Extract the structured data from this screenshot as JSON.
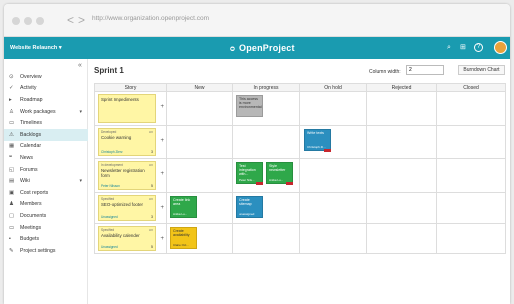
{
  "browser": {
    "url": "http://www.organization.openproject.com",
    "back": "<",
    "forward": ">"
  },
  "header": {
    "project": "Website Relaunch",
    "project_caret": "▾",
    "logo_mark": "ᴑ",
    "logo": "OpenProject",
    "search_icon": "⌕",
    "grid_icon": "⊞",
    "help_icon": "?",
    "accent": "#1a9bb0"
  },
  "sidebar": {
    "collapse": "«",
    "items": [
      {
        "label": "Overview",
        "icon": "⊙"
      },
      {
        "label": "Activity",
        "icon": "✓"
      },
      {
        "label": "Roadmap",
        "icon": "▸"
      },
      {
        "label": "Work packages",
        "icon": "♙",
        "chevron": "▾"
      },
      {
        "label": "Timelines",
        "icon": "▭"
      },
      {
        "label": "Backlogs",
        "icon": "⚠"
      },
      {
        "label": "Calendar",
        "icon": "▦"
      },
      {
        "label": "News",
        "icon": "❝"
      },
      {
        "label": "Forums",
        "icon": "◱"
      },
      {
        "label": "Wiki",
        "icon": "▤",
        "chevron": "▾"
      },
      {
        "label": "Cost reports",
        "icon": "▣"
      },
      {
        "label": "Members",
        "icon": "♟"
      },
      {
        "label": "Documents",
        "icon": "▢"
      },
      {
        "label": "Meetings",
        "icon": "▭"
      },
      {
        "label": "Budgets",
        "icon": "▪"
      },
      {
        "label": "Project settings",
        "icon": "✎"
      }
    ]
  },
  "main": {
    "title": "Sprint 1",
    "column_width_label": "Column width:",
    "column_width_value": "2",
    "burndown_label": "Burndown Chart",
    "columns": [
      "Story",
      "New",
      "In progress",
      "On hold",
      "Rejected",
      "Closed"
    ],
    "stories": [
      {
        "type": "",
        "title": "Sprint Impediments",
        "assignee": "",
        "points": "",
        "badge": ""
      },
      {
        "type": "Developed",
        "title": "Cookie warning",
        "assignee": "Christoph Zierz",
        "points": "3",
        "badge": "UV"
      },
      {
        "type": "In development",
        "title": "Newsletter registration form",
        "assignee": "Peter Nilsson",
        "points": "5",
        "badge": "UV"
      },
      {
        "type": "Specified",
        "title": "SEO-optimized footer",
        "assignee": "Unassigned",
        "points": "3",
        "badge": "UV"
      },
      {
        "type": "Specified",
        "title": "Availability calender",
        "assignee": "Unassigned",
        "points": "5",
        "badge": "UV"
      }
    ],
    "plus": "+",
    "tasks": {
      "t1": {
        "title": "This access is more environmental",
        "assignee": ""
      },
      "t2": {
        "title": "Write texts",
        "assignee": "Christoph Zi..."
      },
      "t3": {
        "title": "Test integration with...",
        "assignee": "Peter Nils..."
      },
      "t4": {
        "title": "Style newsletter",
        "assignee": "Anika Lu..."
      },
      "t5": {
        "title": "Create link area",
        "assignee": "Anika Lu..."
      },
      "t6": {
        "title": "Create sitemap",
        "assignee": "unassigned"
      },
      "t7": {
        "title": "Create availability",
        "assignee": "Claire Oct..."
      }
    }
  }
}
